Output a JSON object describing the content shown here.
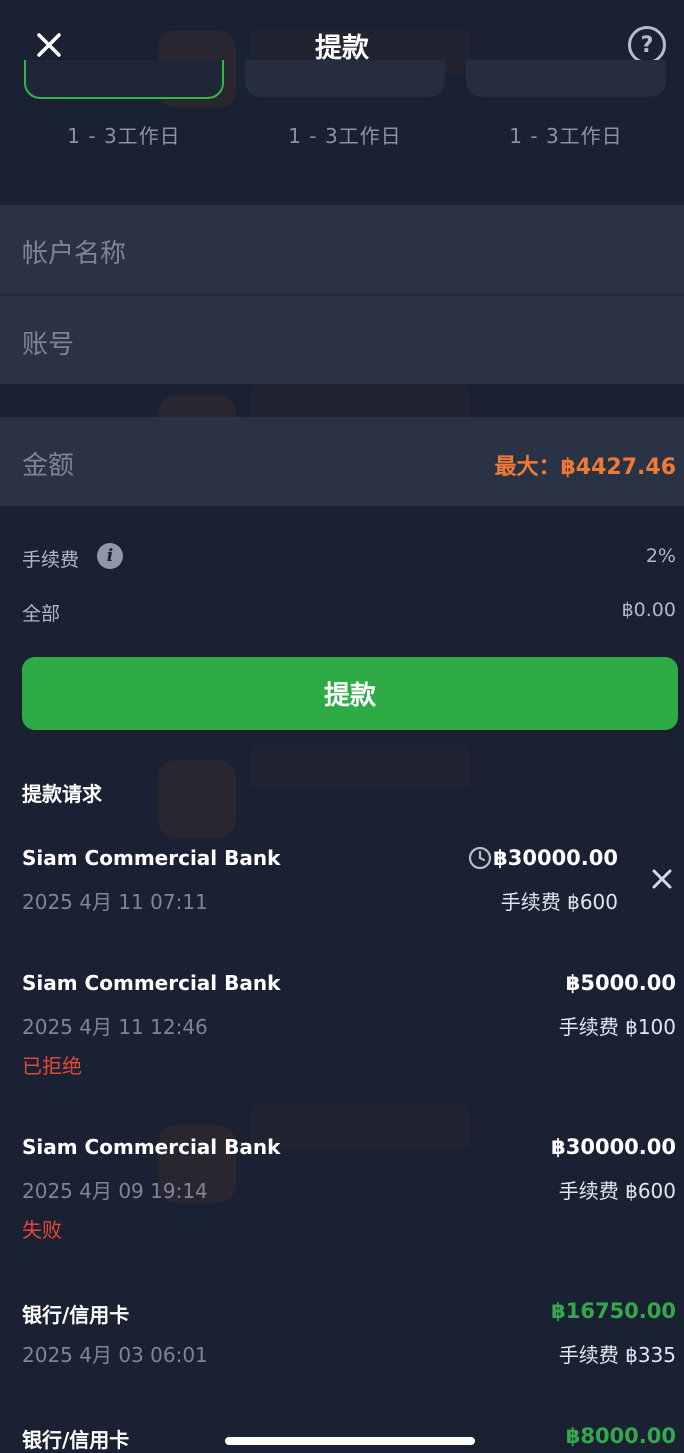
{
  "header": {
    "title": "提款",
    "close_icon": "close-icon",
    "help_glyph": "?"
  },
  "methods": [
    {
      "label": "1 - 3工作日",
      "selected": true
    },
    {
      "label": "1 - 3工作日",
      "selected": false
    },
    {
      "label": "1 - 3工作日",
      "selected": false
    }
  ],
  "form": {
    "account_name_placeholder": "帐户名称",
    "account_number_placeholder": "账号",
    "amount_placeholder": "金额",
    "max_amount": "最大：฿4427.46"
  },
  "fees": {
    "fee_label": "手续费",
    "fee_value": "2%",
    "total_label": "全部",
    "total_value": "฿0.00"
  },
  "submit_label": "提款",
  "requests_title": "提款请求",
  "requests": [
    {
      "bank": "Siam Commercial Bank",
      "date": "2025 4月 11 07:11",
      "amount": "฿30000.00",
      "fee": "手续费 ฿600",
      "status": "",
      "pending": true
    },
    {
      "bank": "Siam Commercial Bank",
      "date": "2025 4月 11 12:46",
      "amount": "฿5000.00",
      "fee": "手续费 ฿100",
      "status": "已拒绝",
      "pending": false
    },
    {
      "bank": "Siam Commercial Bank",
      "date": "2025 4月 09 19:14",
      "amount": "฿30000.00",
      "fee": "手续费 ฿600",
      "status": "失败",
      "pending": false
    },
    {
      "bank": "银行/信用卡",
      "date": "2025 4月 03 06:01",
      "amount": "฿16750.00",
      "fee": "手续费 ฿335",
      "status": "",
      "pending": false
    },
    {
      "bank": "银行/信用卡",
      "date": "",
      "amount": "฿8000.00",
      "fee": "",
      "status": "",
      "pending": false
    }
  ],
  "colors": {
    "background": "#1a2132",
    "accent_green": "#2fab46",
    "max_orange": "#ef7a36",
    "status_red": "#e2483a",
    "success_green": "#34a84a"
  }
}
